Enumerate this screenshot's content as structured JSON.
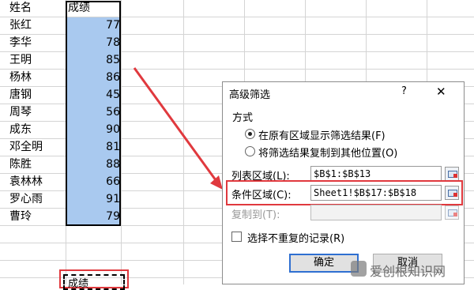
{
  "sheet": {
    "header_name": "姓名",
    "header_score": "成绩",
    "rows": [
      {
        "name": "张红",
        "score": "77"
      },
      {
        "name": "李华",
        "score": "78"
      },
      {
        "name": "王明",
        "score": "85"
      },
      {
        "name": "杨林",
        "score": "86"
      },
      {
        "name": "唐钢",
        "score": "45"
      },
      {
        "name": "周琴",
        "score": "56"
      },
      {
        "name": "成东",
        "score": "90"
      },
      {
        "name": "邓全明",
        "score": "81"
      },
      {
        "name": "陈胜",
        "score": "88"
      },
      {
        "name": "袁林林",
        "score": "66"
      },
      {
        "name": "罗心雨",
        "score": "91"
      },
      {
        "name": "曹玲",
        "score": "79"
      }
    ],
    "criteria_partial": "成绩"
  },
  "dialog": {
    "title": "高级筛选",
    "help": "?",
    "close": "✕",
    "group_label": "方式",
    "option1": "在原有区域显示筛选结果(F)",
    "option2": "将筛选结果复制到其他位置(O)",
    "list_label": "列表区域(L):",
    "list_value": "$B$1:$B$13",
    "criteria_label": "条件区域(C):",
    "criteria_value": "Sheet1!$B$17:$B$18",
    "copyto_label": "复制到(T):",
    "copyto_value": "",
    "unique_label": "选择不重复的记录(R)",
    "ok": "确定",
    "cancel": "取消"
  },
  "colors": {
    "selection": "#a9c9ef",
    "highlight": "#e0393e",
    "default_button": "#2f6fd1"
  },
  "watermark": "爱创根知识网"
}
